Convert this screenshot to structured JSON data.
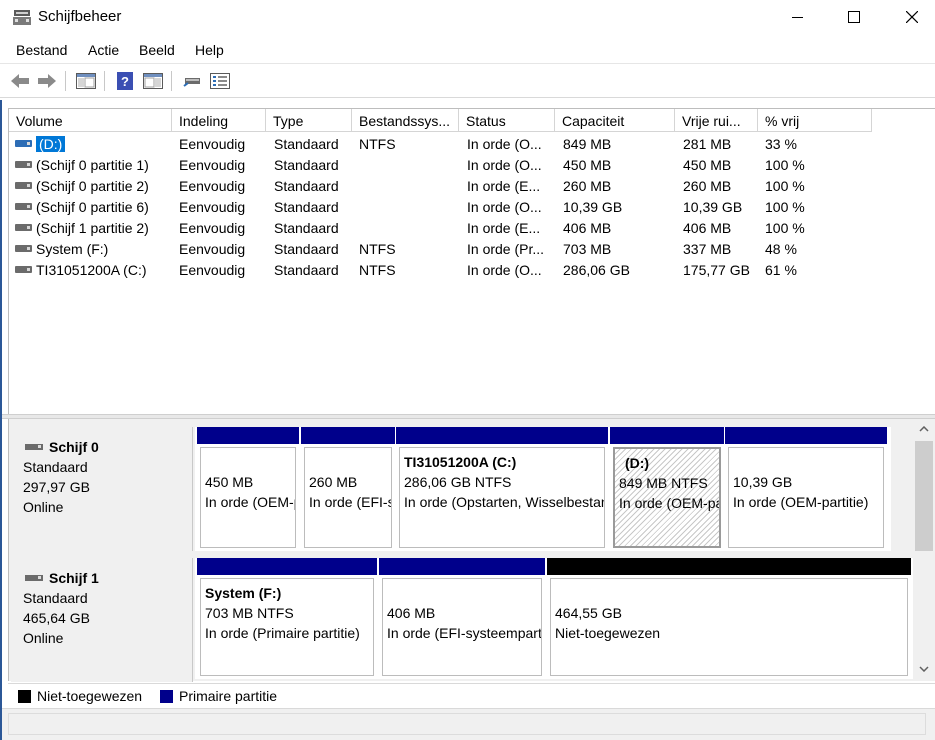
{
  "window": {
    "title": "Schijfbeheer",
    "app_icon": "disk-management-icon",
    "controls": [
      "minimize-icon",
      "maximize-icon",
      "close-icon"
    ]
  },
  "menu": [
    "Bestand",
    "Actie",
    "Beeld",
    "Help"
  ],
  "toolbar": {
    "buttons": [
      "back-icon",
      "forward-icon",
      "console-tree-icon",
      "help-icon",
      "action-pane-icon",
      "connect-drive-icon",
      "properties-icon"
    ]
  },
  "volume_list": {
    "columns": [
      "Volume",
      "Indeling",
      "Type",
      "Bestandssys...",
      "Status",
      "Capaciteit",
      "Vrije rui...",
      "% vrij"
    ],
    "rows": [
      {
        "volume": "(D:)",
        "indeling": "Eenvoudig",
        "type": "Standaard",
        "fs": "NTFS",
        "status": "In orde (O...",
        "capaciteit": "849 MB",
        "vrij": "281 MB",
        "pct": "33 %",
        "selected": true
      },
      {
        "volume": "(Schijf 0 partitie 1)",
        "indeling": "Eenvoudig",
        "type": "Standaard",
        "fs": "",
        "status": "In orde (O...",
        "capaciteit": "450 MB",
        "vrij": "450 MB",
        "pct": "100 %"
      },
      {
        "volume": "(Schijf 0 partitie 2)",
        "indeling": "Eenvoudig",
        "type": "Standaard",
        "fs": "",
        "status": "In orde (E...",
        "capaciteit": "260 MB",
        "vrij": "260 MB",
        "pct": "100 %"
      },
      {
        "volume": "(Schijf 0 partitie 6)",
        "indeling": "Eenvoudig",
        "type": "Standaard",
        "fs": "",
        "status": "In orde (O...",
        "capaciteit": "10,39 GB",
        "vrij": "10,39 GB",
        "pct": "100 %"
      },
      {
        "volume": "(Schijf 1 partitie 2)",
        "indeling": "Eenvoudig",
        "type": "Standaard",
        "fs": "",
        "status": "In orde (E...",
        "capaciteit": "406 MB",
        "vrij": "406 MB",
        "pct": "100 %"
      },
      {
        "volume": "System (F:)",
        "indeling": "Eenvoudig",
        "type": "Standaard",
        "fs": "NTFS",
        "status": "In orde (Pr...",
        "capaciteit": "703 MB",
        "vrij": "337 MB",
        "pct": "48 %"
      },
      {
        "volume": "TI31051200A (C:)",
        "indeling": "Eenvoudig",
        "type": "Standaard",
        "fs": "NTFS",
        "status": "In orde (O...",
        "capaciteit": "286,06 GB",
        "vrij": "175,77 GB",
        "pct": "61 %"
      }
    ]
  },
  "disks": [
    {
      "name": "Schijf 0",
      "type": "Standaard",
      "size": "297,97 GB",
      "state": "Online",
      "partitions": [
        {
          "title": "",
          "size": "450 MB",
          "status": "In orde (OEM-partitie)",
          "kind": "primary"
        },
        {
          "title": "",
          "size": "260 MB",
          "status": "In orde (EFI-systeempartitie)",
          "kind": "primary"
        },
        {
          "title": "TI31051200A  (C:)",
          "size": "286,06 GB NTFS",
          "status": "In orde (Opstarten, Wisselbestand)",
          "kind": "primary"
        },
        {
          "title": "(D:)",
          "size": "849 MB NTFS",
          "status": "In orde (OEM-partitie)",
          "kind": "primary",
          "selected": true
        },
        {
          "title": "",
          "size": "10,39 GB",
          "status": "In orde (OEM-partitie)",
          "kind": "primary"
        }
      ]
    },
    {
      "name": "Schijf 1",
      "type": "Standaard",
      "size": "465,64 GB",
      "state": "Online",
      "partitions": [
        {
          "title": "System  (F:)",
          "size": "703 MB NTFS",
          "status": "In orde (Primaire partitie)",
          "kind": "primary"
        },
        {
          "title": "",
          "size": "406 MB",
          "status": "In orde (EFI-systeempartitie)",
          "kind": "primary"
        },
        {
          "title": "",
          "size": "464,55 GB",
          "status": "Niet-toegewezen",
          "kind": "unallocated"
        }
      ]
    }
  ],
  "legend": [
    {
      "label": "Niet-toegewezen",
      "color": "#000000"
    },
    {
      "label": "Primaire partitie",
      "color": "#00008b"
    }
  ]
}
